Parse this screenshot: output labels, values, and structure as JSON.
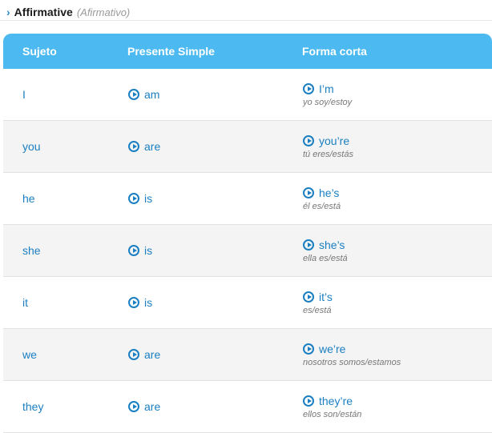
{
  "section": {
    "title": "Affirmative",
    "subtitle": "(Afirmativo)"
  },
  "table": {
    "headers": [
      "Sujeto",
      "Presente Simple",
      "Forma corta"
    ],
    "rows": [
      {
        "subject": "I",
        "present": "am",
        "short": "I’m",
        "translation": "yo soy/estoy"
      },
      {
        "subject": "you",
        "present": "are",
        "short": "you’re",
        "translation": "tú eres/estás"
      },
      {
        "subject": "he",
        "present": "is",
        "short": "he’s",
        "translation": "él es/está"
      },
      {
        "subject": "she",
        "present": "is",
        "short": "she’s",
        "translation": "ella es/está"
      },
      {
        "subject": "it",
        "present": "is",
        "short": "it’s",
        "translation": "es/está"
      },
      {
        "subject": "we",
        "present": "are",
        "short": "we’re",
        "translation": "nosotros somos/estamos"
      },
      {
        "subject": "they",
        "present": "are",
        "short": "they’re",
        "translation": "ellos son/están"
      }
    ]
  },
  "colors": {
    "header_bg": "#4cbaf1",
    "link": "#1a7fc2"
  },
  "icons": {
    "header_chevron": "chevron-right-icon",
    "play": "play-circle-icon"
  }
}
